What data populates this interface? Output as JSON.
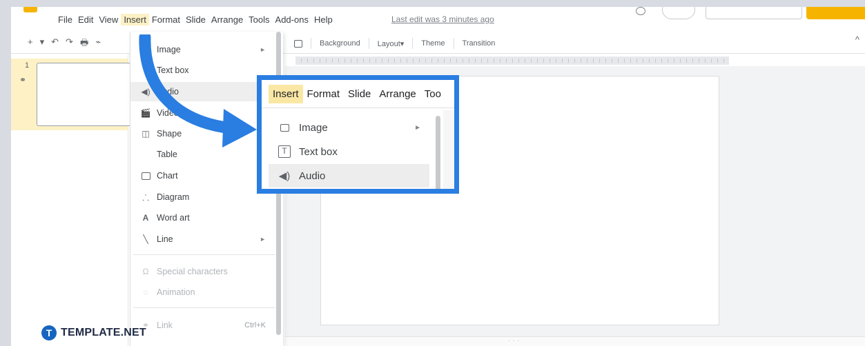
{
  "menubar": {
    "items": [
      "File",
      "Edit",
      "View",
      "Insert",
      "Format",
      "Slide",
      "Arrange",
      "Tools",
      "Add-ons",
      "Help"
    ],
    "active_index": 3,
    "last_edit": "Last edit was 3 minutes ago"
  },
  "toolbar": {
    "left_icons": [
      "+",
      "▾",
      "↶",
      "↷",
      "🖶",
      "⌁"
    ],
    "background_label": "Background",
    "layout_label": "Layout▾",
    "theme_label": "Theme",
    "transition_label": "Transition",
    "collapse_icon": "^"
  },
  "filmstrip": {
    "slide_number": "1",
    "link_icon": "⚭"
  },
  "dropdown": {
    "items": [
      {
        "label": "Image",
        "icon": "image-icon",
        "glyph": "",
        "submenu": true,
        "disabled": false
      },
      {
        "label": "Text box",
        "icon": "textbox-icon",
        "glyph": "T",
        "submenu": false,
        "disabled": false
      },
      {
        "label": "Audio",
        "icon": "audio-icon",
        "glyph": "◀)",
        "submenu": false,
        "disabled": false,
        "hover": true
      },
      {
        "label": "Video",
        "icon": "video-icon",
        "glyph": "🎬",
        "submenu": false,
        "disabled": false
      },
      {
        "label": "Shape",
        "icon": "shape-icon",
        "glyph": "◫",
        "submenu": true,
        "disabled": false
      },
      {
        "label": "Table",
        "icon": "table-icon",
        "glyph": "",
        "submenu": true,
        "disabled": false
      },
      {
        "label": "Chart",
        "icon": "chart-icon",
        "glyph": "📊",
        "submenu": true,
        "disabled": false
      },
      {
        "label": "Diagram",
        "icon": "diagram-icon",
        "glyph": "⸫",
        "submenu": false,
        "disabled": false
      },
      {
        "label": "Word art",
        "icon": "wordart-icon",
        "glyph": "A",
        "submenu": false,
        "disabled": false
      },
      {
        "label": "Line",
        "icon": "line-icon",
        "glyph": "╲",
        "submenu": true,
        "disabled": false
      },
      {
        "label": "Special characters",
        "icon": "omega-icon",
        "glyph": "Ω",
        "submenu": false,
        "disabled": true
      },
      {
        "label": "Animation",
        "icon": "animation-icon",
        "glyph": "◌",
        "submenu": false,
        "disabled": true
      },
      {
        "label": "Link",
        "icon": "link-icon",
        "glyph": "⚭",
        "shortcut": "Ctrl+K",
        "submenu": false,
        "disabled": true
      }
    ],
    "submenu_arrow": "►"
  },
  "callout": {
    "menus": [
      "Insert",
      "Format",
      "Slide",
      "Arrange",
      "Too"
    ],
    "active_index": 0,
    "items": [
      {
        "label": "Image",
        "icon": "image-icon",
        "submenu": true
      },
      {
        "label": "Text box",
        "icon": "textbox-icon",
        "submenu": false
      },
      {
        "label": "Audio",
        "icon": "audio-icon",
        "submenu": false,
        "hover": true
      }
    ],
    "border_color": "#2a7de1"
  },
  "watermark": {
    "badge": "T",
    "text": "TEMPLATE.NET"
  },
  "colors": {
    "accent_blue": "#2a7de1",
    "menu_highlight": "#fdf1c5",
    "brand_yellow": "#f6b400"
  }
}
